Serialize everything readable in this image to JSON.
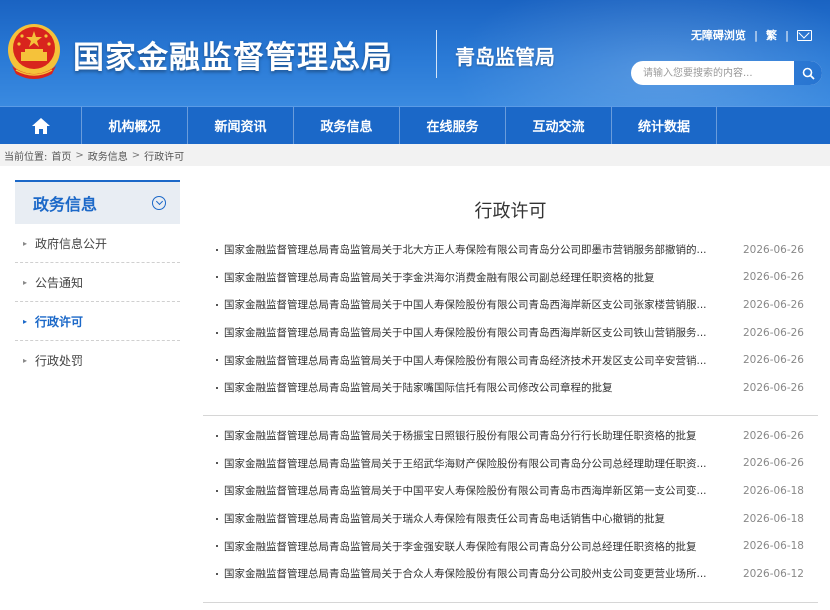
{
  "header": {
    "site_title": "国家金融监督管理总局",
    "branch_title": "青岛监管局",
    "accessibility_label": "无障碍浏览",
    "simplified_label": "繁",
    "search_placeholder": "请输入您要搜索的内容..."
  },
  "nav": {
    "items": [
      "机构概况",
      "新闻资讯",
      "政务信息",
      "在线服务",
      "互动交流",
      "统计数据"
    ]
  },
  "breadcrumb": {
    "prefix": "当前位置:",
    "items": [
      "首页",
      "政务信息",
      "行政许可"
    ]
  },
  "sidebar": {
    "title": "政务信息",
    "items": [
      {
        "label": "政府信息公开",
        "active": false
      },
      {
        "label": "公告通知",
        "active": false
      },
      {
        "label": "行政许可",
        "active": true
      },
      {
        "label": "行政处罚",
        "active": false
      }
    ]
  },
  "main": {
    "title": "行政许可",
    "groups": [
      [
        {
          "title": "国家金融监督管理总局青岛监管局关于北大方正人寿保险有限公司青岛分公司即墨市营销服务部撤销的...",
          "date": "2026-06-26"
        },
        {
          "title": "国家金融监督管理总局青岛监管局关于李金洪海尔消费金融有限公司副总经理任职资格的批复",
          "date": "2026-06-26"
        },
        {
          "title": "国家金融监督管理总局青岛监管局关于中国人寿保险股份有限公司青岛西海岸新区支公司张家楼营销服...",
          "date": "2026-06-26"
        },
        {
          "title": "国家金融监督管理总局青岛监管局关于中国人寿保险股份有限公司青岛西海岸新区支公司铁山营销服务...",
          "date": "2026-06-26"
        },
        {
          "title": "国家金融监督管理总局青岛监管局关于中国人寿保险股份有限公司青岛经济技术开发区支公司辛安营销...",
          "date": "2026-06-26"
        },
        {
          "title": "国家金融监督管理总局青岛监管局关于陆家嘴国际信托有限公司修改公司章程的批复",
          "date": "2026-06-26"
        }
      ],
      [
        {
          "title": "国家金融监督管理总局青岛监管局关于杨振宝日照银行股份有限公司青岛分行行长助理任职资格的批复",
          "date": "2026-06-26"
        },
        {
          "title": "国家金融监督管理总局青岛监管局关于王绍武华海财产保险股份有限公司青岛分公司总经理助理任职资...",
          "date": "2026-06-26"
        },
        {
          "title": "国家金融监督管理总局青岛监管局关于中国平安人寿保险股份有限公司青岛市西海岸新区第一支公司变...",
          "date": "2026-06-18"
        },
        {
          "title": "国家金融监督管理总局青岛监管局关于瑞众人寿保险有限责任公司青岛电话销售中心撤销的批复",
          "date": "2026-06-18"
        },
        {
          "title": "国家金融监督管理总局青岛监管局关于李金强安联人寿保险有限公司青岛分公司总经理任职资格的批复",
          "date": "2026-06-18"
        },
        {
          "title": "国家金融监督管理总局青岛监管局关于合众人寿保险股份有限公司青岛分公司胶州支公司变更营业场所...",
          "date": "2026-06-12"
        }
      ]
    ]
  },
  "colors": {
    "primary_blue": "#1b68c8",
    "header_gradient_top": "#1a63c2",
    "emblem_red": "#d8241d",
    "emblem_gold": "#f5c23a"
  },
  "icons": {
    "home": "home-icon",
    "search": "search-icon",
    "mail": "mail-icon",
    "emblem": "national-emblem-icon",
    "collapse": "chevron-down-circle-icon"
  }
}
